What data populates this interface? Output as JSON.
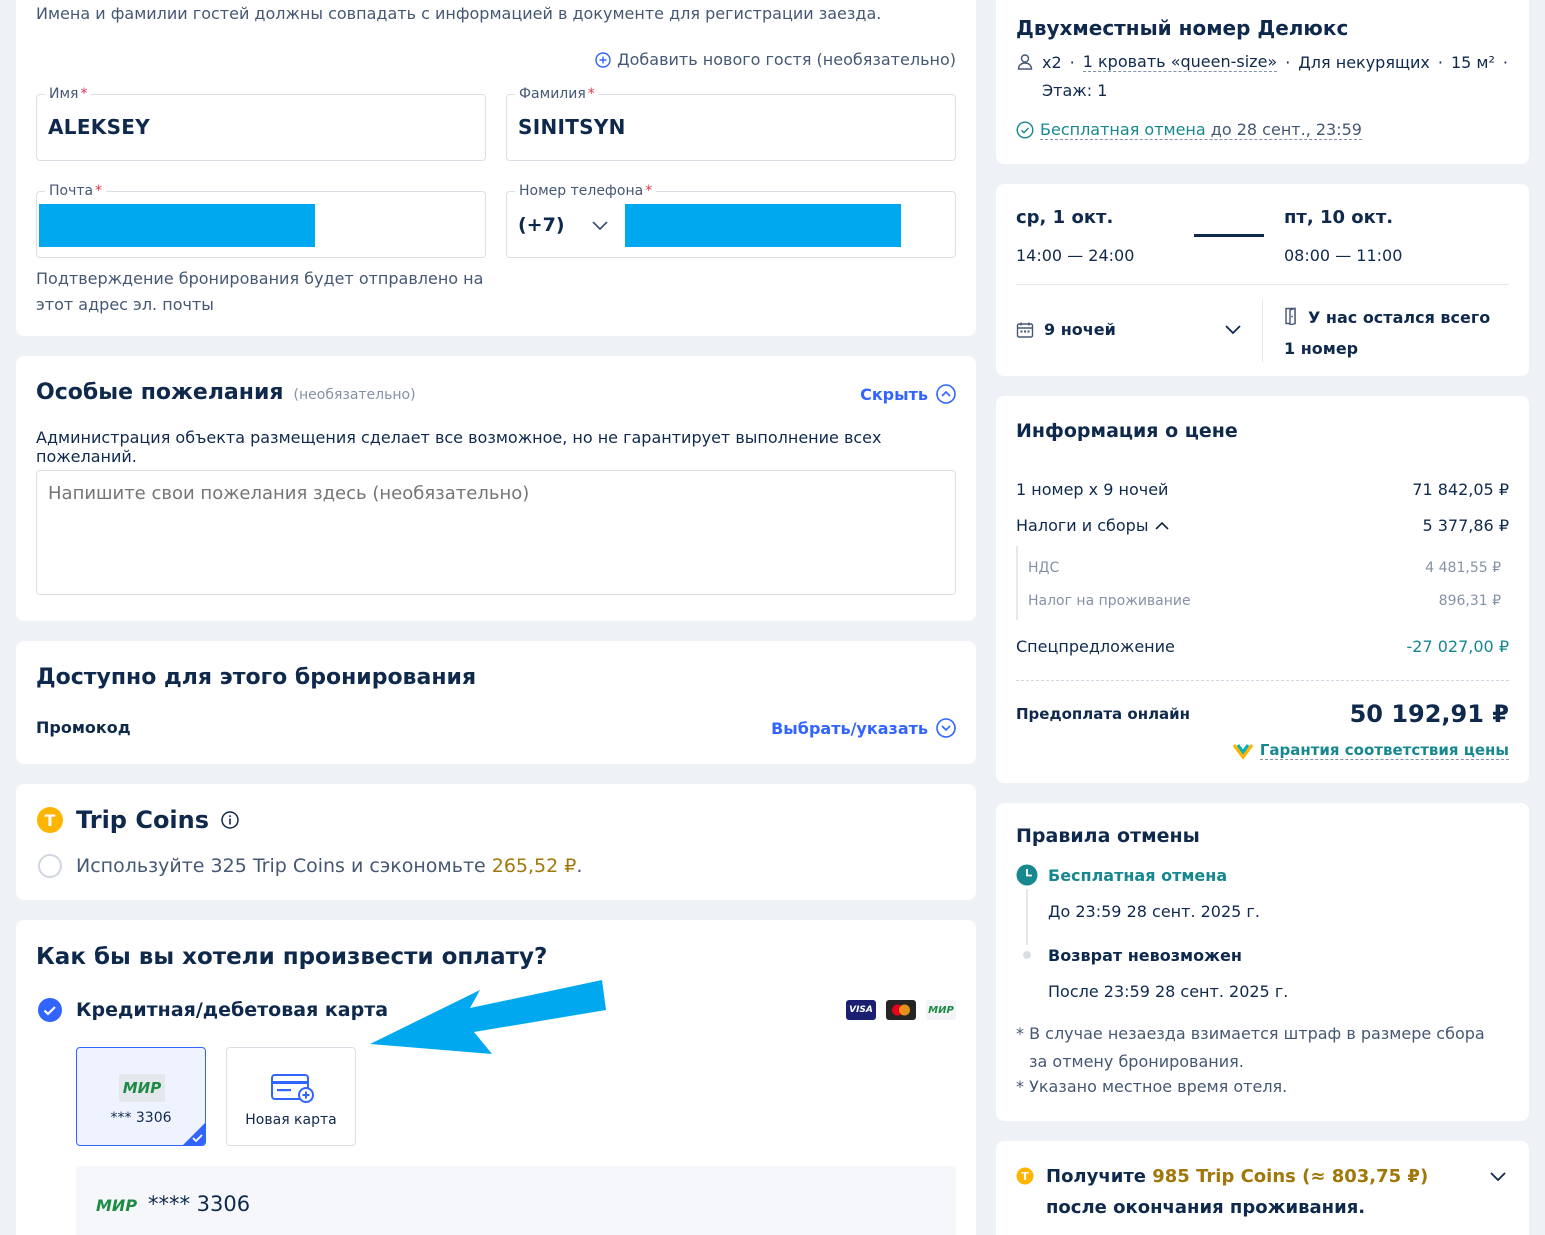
{
  "guest": {
    "notice": "Имена и фамилии гостей должны совпадать с информацией в документе для регистрации заезда.",
    "add_guest": "Добавить нового гостя (необязательно)",
    "first_name_label": "Имя",
    "first_name_value": "ALEKSEY",
    "last_name_label": "Фамилия",
    "last_name_value": "SINITSYN",
    "email_label": "Почта",
    "phone_label": "Номер телефона",
    "phone_code": "(+7)",
    "email_hint": "Подтверждение бронирования будет отправлено на этот адрес эл. почты"
  },
  "requests": {
    "title": "Особые пожелания",
    "optional": "(необязательно)",
    "hide": "Скрыть",
    "note": "Администрация объекта размещения сделает все возможное, но не гарантирует выполнение всех пожеланий.",
    "placeholder": "Напишите свои пожелания здесь (необязательно)"
  },
  "available": {
    "title": "Доступно для этого бронирования",
    "promo_label": "Промокод",
    "promo_action": "Выбрать/указать"
  },
  "tripcoins": {
    "title": "Trip Coins",
    "use_text": "Используйте 325 Trip Coins и сэкономьте",
    "save_amount": "265,52 ₽",
    "dot": "."
  },
  "payment": {
    "title": "Как бы вы хотели произвести оплату?",
    "method": "Кредитная/дебетовая карта",
    "brands": [
      "VISA",
      "mastercard",
      "МИР"
    ],
    "saved_card_brand": "МИР",
    "saved_card_number": "*** 3306",
    "new_card": "Новая карта",
    "selected_brand": "МИР",
    "selected_number": "**** 3306"
  },
  "room": {
    "title": "Двухместный номер Делюкс",
    "guests": "x2",
    "bed": "1 кровать «queen-size»",
    "smoking": "Для некурящих",
    "area": "15 м²",
    "floor": "Этаж: 1",
    "free_cancel": "Бесплатная отмена",
    "free_cancel_until": "до 28 сент., 23:59"
  },
  "dates": {
    "checkin_date": "ср, 1 окт.",
    "checkin_time": "14:00 — 24:00",
    "checkout_date": "пт, 10 окт.",
    "checkout_time": "08:00 — 11:00",
    "nights": "9 ночей",
    "availability": "У нас остался всего 1 номер"
  },
  "price": {
    "title": "Информация о цене",
    "rows": [
      {
        "label": "1 номер x 9 ночей",
        "value": "71 842,05 ₽"
      },
      {
        "label": "Налоги и сборы",
        "value": "5 377,86 ₽"
      }
    ],
    "sub_rows": [
      {
        "label": "НДС",
        "value": "4 481,55 ₽"
      },
      {
        "label": "Налог на проживание",
        "value": "896,31 ₽"
      }
    ],
    "special_label": "Спецпредложение",
    "special_value": "-27 027,00 ₽",
    "prepay_label": "Предоплата онлайн",
    "prepay_value": "50 192,91 ₽",
    "guarantee": "Гарантия соответствия цены"
  },
  "cancel": {
    "title": "Правила отмены",
    "free_title": "Бесплатная отмена",
    "free_until": "До 23:59 28 сент. 2025 г.",
    "nonref_title": "Возврат невозможен",
    "nonref_after": "После 23:59 28 сент. 2025 г.",
    "note1": "* В случае незаезда взимается штраф в размере сбора за отмену бронирования.",
    "note2": "* Указано местное время отеля."
  },
  "earn": {
    "prefix": "Получите",
    "coins": "985 Trip Coins (≈ 803,75 ₽)",
    "suffix": "после окончания проживания."
  },
  "colors": {
    "accent": "#3264ff",
    "teal": "#17888f",
    "gold": "#a0780a",
    "redaction": "#00a9ef"
  }
}
